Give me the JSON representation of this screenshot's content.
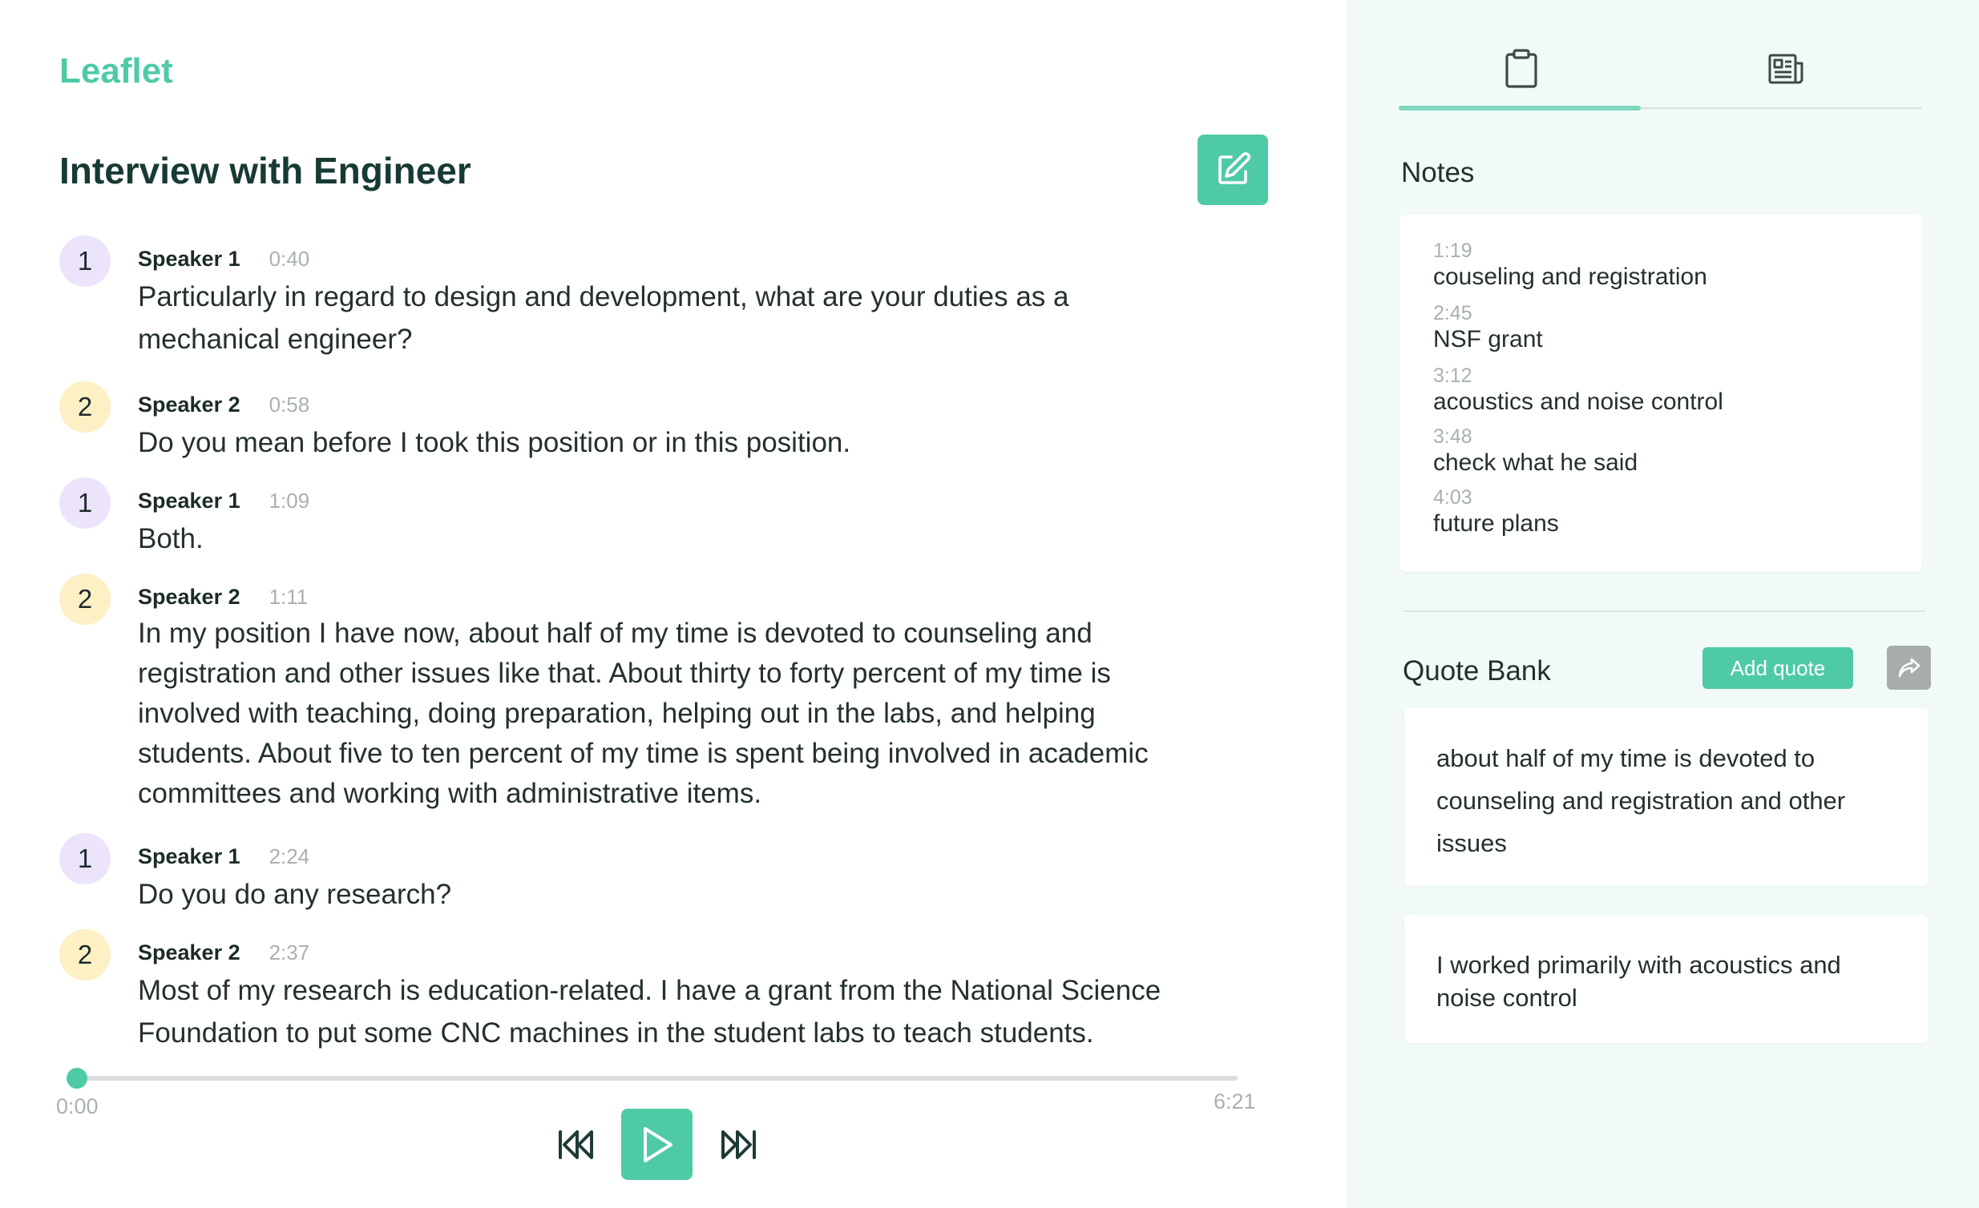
{
  "app": {
    "logo": "Leaflet"
  },
  "transcript": {
    "title": "Interview with Engineer",
    "segments": [
      {
        "badge": "1",
        "speaker": "Speaker 1",
        "time": "0:40",
        "text": "Particularly in regard to design and development, what are your duties as a mechanical engineer?"
      },
      {
        "badge": "2",
        "speaker": "Speaker 2",
        "time": "0:58",
        "text": "Do you mean before I took this position or in this position."
      },
      {
        "badge": "1",
        "speaker": "Speaker 1",
        "time": "1:09",
        "text": "Both."
      },
      {
        "badge": "2",
        "speaker": "Speaker 2",
        "time": "1:11",
        "text": "In my position I have now, about half of my time is devoted to counseling and registration and other issues like that. About thirty to forty percent of my time is involved with teaching, doing preparation, helping out in the labs, and helping students. About five to ten percent of my time is spent being involved in academic committees and working with administrative items."
      },
      {
        "badge": "1",
        "speaker": "Speaker 1",
        "time": "2:24",
        "text": "Do you do any research?"
      },
      {
        "badge": "2",
        "speaker": "Speaker 2",
        "time": "2:37",
        "text": "Most of my research is education-related. I have a grant from the National Science Foundation to put some CNC machines in the student labs to teach students."
      }
    ]
  },
  "player": {
    "current_time": "0:00",
    "duration": "6:21",
    "progress": 0.0,
    "accent_color": "#4fcaa6"
  },
  "sidebar": {
    "tabs": [
      {
        "icon": "clipboard-icon",
        "active": true
      },
      {
        "icon": "document-icon",
        "active": false
      }
    ],
    "notes_heading": "Notes",
    "notes": [
      {
        "time": "1:19",
        "text": "couseling and registration"
      },
      {
        "time": "2:45",
        "text": "NSF grant"
      },
      {
        "time": "3:12",
        "text": "acoustics and noise control"
      },
      {
        "time": "3:48",
        "text": "check what he said"
      },
      {
        "time": "4:03",
        "text": "future plans"
      }
    ],
    "quote_bank_heading": "Quote Bank",
    "add_quote_label": "Add quote",
    "quotes": [
      "about half of my time is devoted to counseling and registration and other issues",
      "I worked primarily with acoustics and noise control"
    ]
  }
}
